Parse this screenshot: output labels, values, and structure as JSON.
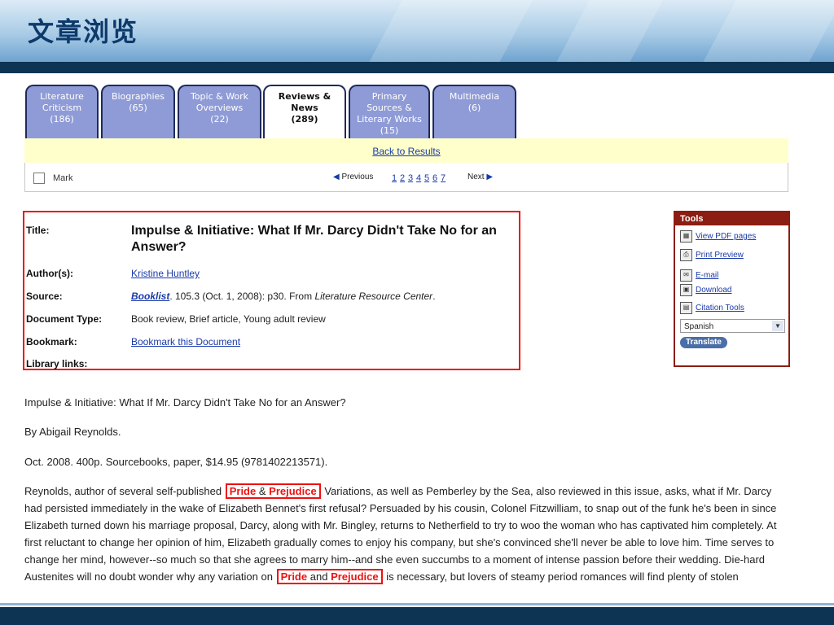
{
  "slide": {
    "title": "文章浏览"
  },
  "tabs": [
    {
      "label": "Literature Criticism",
      "count": "(186)"
    },
    {
      "label": "Biographies",
      "count": "(65)"
    },
    {
      "label": "Topic & Work Overviews",
      "count": "(22)"
    },
    {
      "label": "Reviews & News",
      "count": "(289)"
    },
    {
      "label": "Primary Sources & Literary Works",
      "count": "(15)"
    },
    {
      "label": "Multimedia",
      "count": "(6)"
    }
  ],
  "results": {
    "back_link": "Back to Results"
  },
  "nav": {
    "mark_label": "Mark",
    "previous": "Previous",
    "next": "Next",
    "pages": [
      "1",
      "2",
      "3",
      "4",
      "5",
      "6",
      "7"
    ]
  },
  "meta": {
    "title_label": "Title:",
    "title": "Impulse & Initiative: What If Mr. Darcy Didn't Take No for an Answer?",
    "author_label": "Author(s):",
    "author": "Kristine Huntley",
    "source_label": "Source:",
    "source_pub": "Booklist",
    "source_rest": ". 105.3 (Oct. 1, 2008): p30. From ",
    "source_db": "Literature Resource Center",
    "source_end": ".",
    "doctype_label": "Document Type:",
    "doctype": "Book review, Brief article, Young adult review",
    "bookmark_label": "Bookmark:",
    "bookmark": "Bookmark this Document",
    "library_label": "Library links:"
  },
  "tools": {
    "heading": "Tools",
    "items": [
      {
        "label": "View PDF pages",
        "icon": "pdf-icon"
      },
      {
        "label": "Print Preview",
        "icon": "printer-icon"
      },
      {
        "label": "E-mail",
        "icon": "email-icon"
      },
      {
        "label": "Download",
        "icon": "save-icon"
      },
      {
        "label": "Citation Tools",
        "icon": "citation-icon"
      }
    ],
    "language": "Spanish",
    "translate": "Translate"
  },
  "article": {
    "title_line": "Impulse & Initiative: What If Mr. Darcy Didn't Take No for an Answer?",
    "byline": "By Abigail Reynolds.",
    "pubinfo": "Oct. 2008. 400p. Sourcebooks, paper, $14.95 (9781402213571).",
    "body_a": "Reynolds, author of several self-published",
    "hl1_a": "Pride",
    "hl1_amp": "&",
    "hl1_b": "Prejudice",
    "body_b": "Variations, as well as Pemberley by the Sea, also reviewed in this issue, asks, what if Mr. Darcy had persisted immediately in the wake of Elizabeth Bennet's first refusal? Persuaded by his cousin, Colonel Fitzwilliam, to snap out of the funk he's been in since Elizabeth turned down his marriage proposal, Darcy, along with Mr. Bingley, returns to Netherfield to try to woo the woman who has captivated him completely. At first reluctant to change her opinion of him, Elizabeth gradually comes to enjoy his company, but she's convinced she'll never be able to love him. Time serves to change her mind, however--so much so that she agrees to marry him--and she even succumbs to a moment of intense passion before their wedding. Die-hard Austenites will no doubt wonder why any variation on",
    "hl2_a": "Pride",
    "hl2_and": "and",
    "hl2_b": "Prejudice",
    "body_c": "is necessary, but lovers of steamy period romances will find plenty of stolen"
  }
}
